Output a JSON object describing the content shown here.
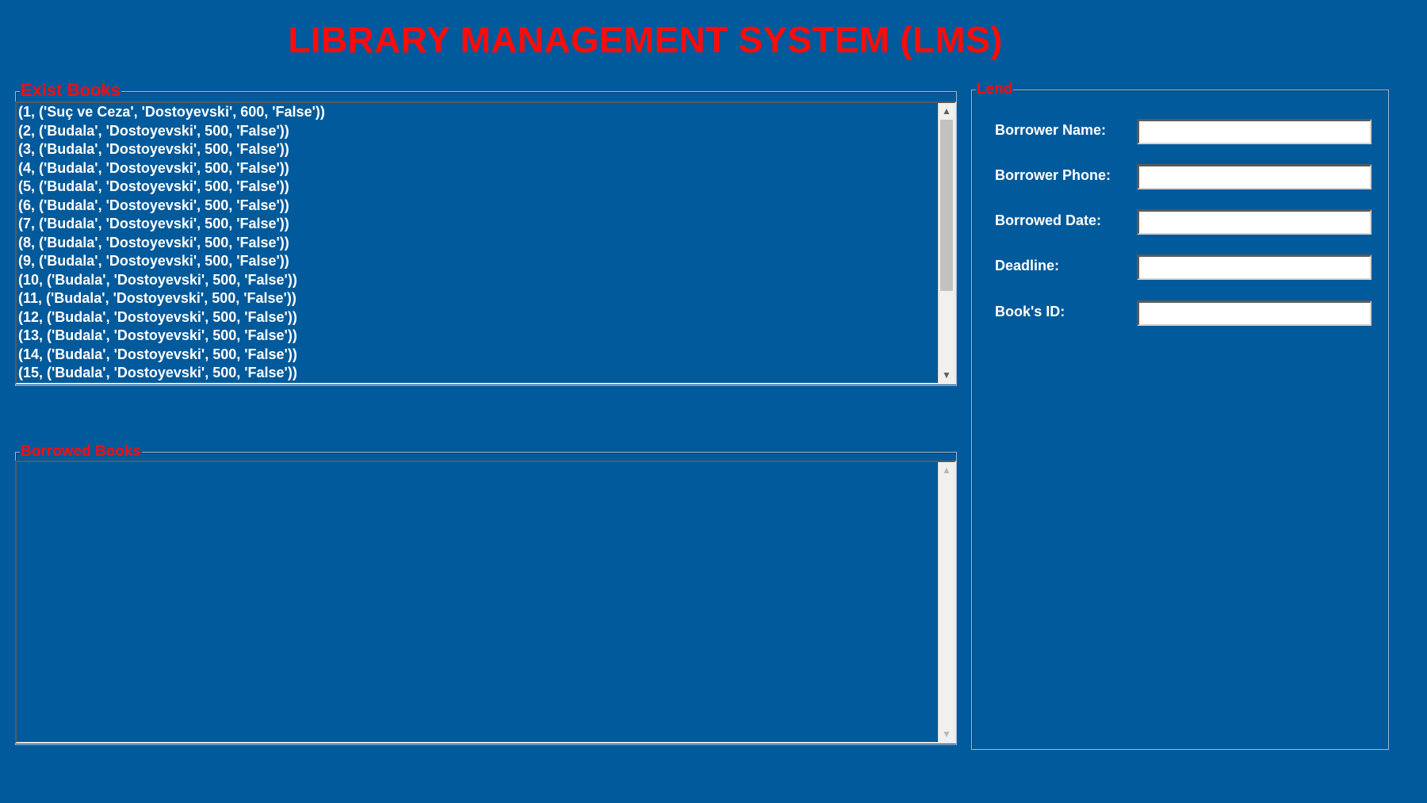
{
  "app": {
    "title": "LIBRARY MANAGEMENT SYSTEM (LMS)"
  },
  "exist_books": {
    "label": "Exist Books",
    "items": [
      "(1, ('Suç ve Ceza', 'Dostoyevski', 600, 'False'))",
      "(2, ('Budala', 'Dostoyevski', 500, 'False'))",
      "(3, ('Budala', 'Dostoyevski', 500, 'False'))",
      "(4, ('Budala', 'Dostoyevski', 500, 'False'))",
      "(5, ('Budala', 'Dostoyevski', 500, 'False'))",
      "(6, ('Budala', 'Dostoyevski', 500, 'False'))",
      "(7, ('Budala', 'Dostoyevski', 500, 'False'))",
      "(8, ('Budala', 'Dostoyevski', 500, 'False'))",
      "(9, ('Budala', 'Dostoyevski', 500, 'False'))",
      "(10, ('Budala', 'Dostoyevski', 500, 'False'))",
      "(11, ('Budala', 'Dostoyevski', 500, 'False'))",
      "(12, ('Budala', 'Dostoyevski', 500, 'False'))",
      "(13, ('Budala', 'Dostoyevski', 500, 'False'))",
      "(14, ('Budala', 'Dostoyevski', 500, 'False'))",
      "(15, ('Budala', 'Dostoyevski', 500, 'False'))"
    ]
  },
  "borrowed_books": {
    "label": "Borrowed Books",
    "items": []
  },
  "lend": {
    "label": "Lend",
    "fields": {
      "borrower_name": {
        "label": "Borrower Name:",
        "value": ""
      },
      "borrower_phone": {
        "label": "Borrower Phone:",
        "value": ""
      },
      "borrowed_date": {
        "label": "Borrowed Date:",
        "value": ""
      },
      "deadline": {
        "label": "Deadline:",
        "value": ""
      },
      "book_id": {
        "label": "Book's ID:",
        "value": ""
      }
    }
  },
  "icons": {
    "scroll_up": "▲",
    "scroll_down": "▼"
  },
  "colors": {
    "background": "#015a9b",
    "title": "#ff0b0b",
    "legend": "#ff0b0b",
    "text": "#ffffff"
  }
}
